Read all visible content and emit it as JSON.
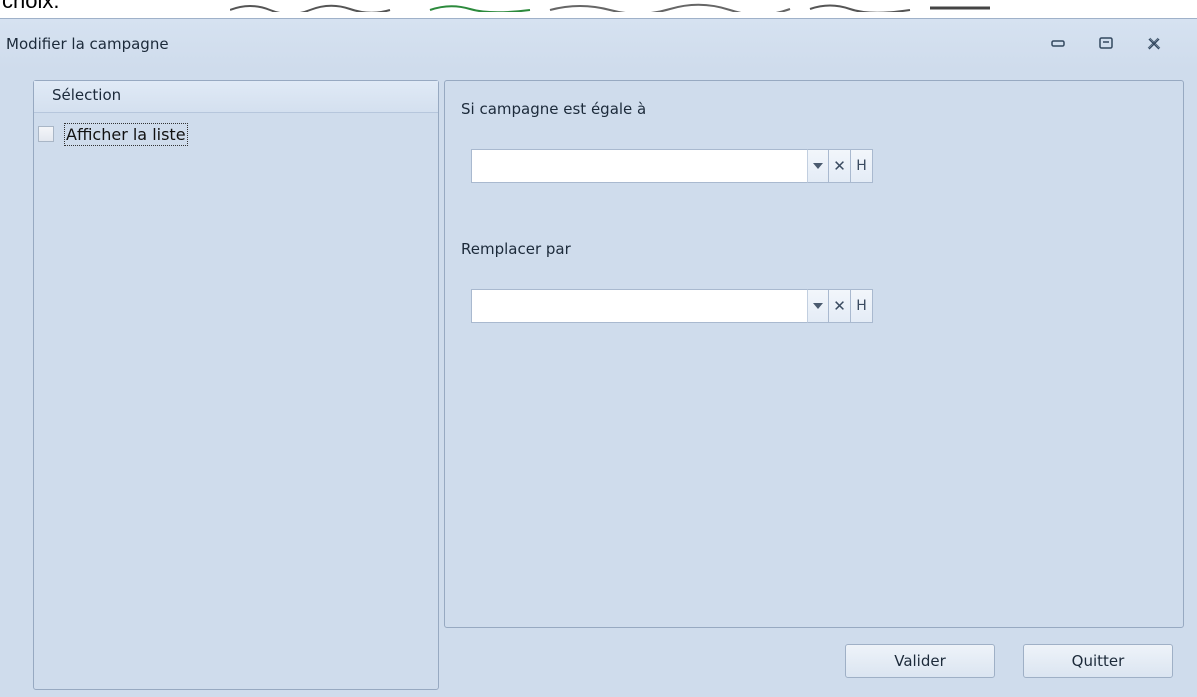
{
  "above_text": "choix.",
  "window": {
    "title": "Modifier la campagne"
  },
  "selection_panel": {
    "header": "Sélection",
    "checkbox_label": "Afficher la liste",
    "checked": false
  },
  "form": {
    "field1_label": "Si campagne est égale à",
    "field1_value": "",
    "field2_label": "Remplacer par",
    "field2_value": "",
    "clear_glyph": "✕",
    "history_glyph": "H"
  },
  "buttons": {
    "validate": "Valider",
    "quit": "Quitter"
  }
}
